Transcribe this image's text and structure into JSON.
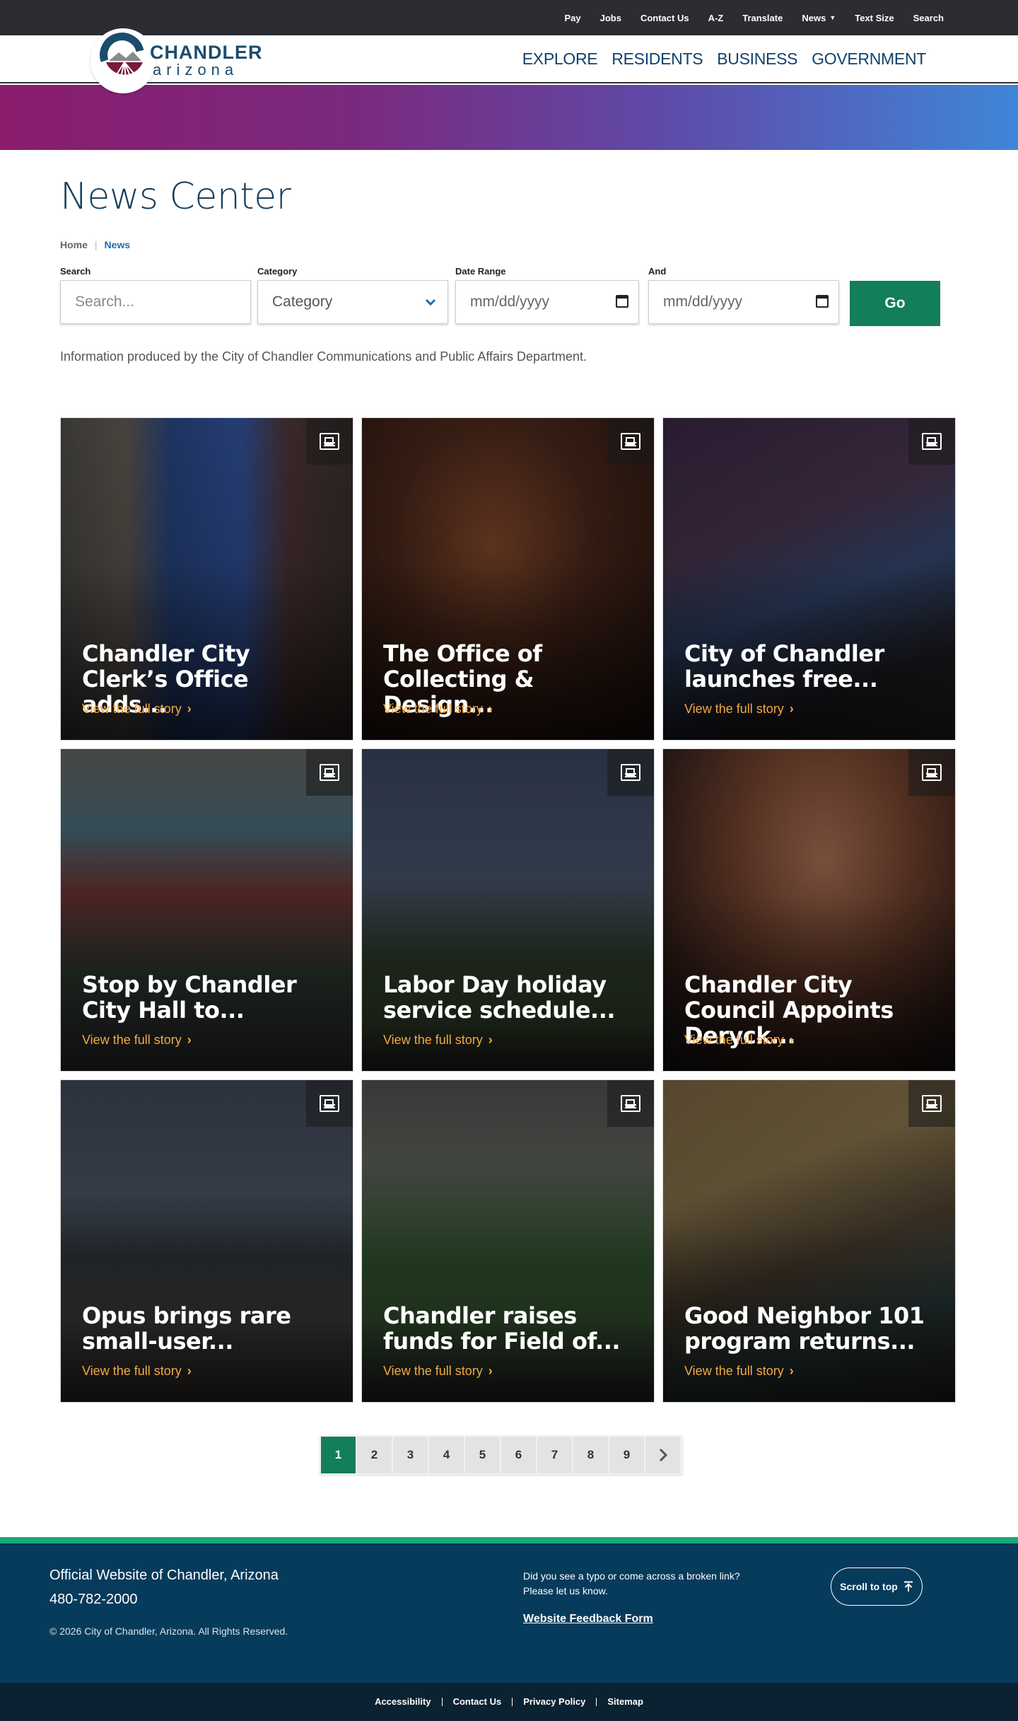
{
  "utility_nav": [
    "Pay",
    "Jobs",
    "Contact Us",
    "A-Z",
    "Translate",
    "News",
    "Text Size",
    "Search"
  ],
  "logo": {
    "line1": "CHANDLER",
    "line2": "arizona"
  },
  "main_nav": [
    "EXPLORE",
    "RESIDENTS",
    "BUSINESS",
    "GOVERNMENT"
  ],
  "page_title": "News Center",
  "breadcrumb": {
    "home": "Home",
    "current": "News"
  },
  "filters": {
    "search_label": "Search",
    "search_placeholder": "Search...",
    "category_label": "Category",
    "category_value": "Category",
    "date_label": "Date Range",
    "date_from": "mm/dd/yyyy",
    "and_label": "And",
    "date_to": "mm/dd/yyyy",
    "go_label": "Go"
  },
  "info_text": "Information produced by the City of Chandler Communications and Public Affairs Department.",
  "cards": [
    {
      "title": "Chandler City Clerk’s Office adds...",
      "link": "View the full story"
    },
    {
      "title": "The Office of Collecting & Design...",
      "link": "View the full story"
    },
    {
      "title": "City of Chandler launches free...",
      "link": "View the full story"
    },
    {
      "title": "Stop by Chandler City Hall to...",
      "link": "View the full story"
    },
    {
      "title": "Labor Day holiday service schedule...",
      "link": "View the full story"
    },
    {
      "title": "Chandler City Council Appoints Deryck...",
      "link": "View the full story"
    },
    {
      "title": "Opus brings rare small-user...",
      "link": "View the full story"
    },
    {
      "title": "Chandler raises funds for Field of...",
      "link": "View the full story"
    },
    {
      "title": "Good Neighbor 101 program returns...",
      "link": "View the full story"
    }
  ],
  "pagination": {
    "pages": [
      "1",
      "2",
      "3",
      "4",
      "5",
      "6",
      "7",
      "8",
      "9"
    ],
    "current": "1",
    "next": "›"
  },
  "footer": {
    "site": "Official Website of Chandler, Arizona",
    "phone": "480-782-2000",
    "copyright": "© 2026 City of Chandler, Arizona. All Rights Reserved.",
    "typo_line1": "Did you see a typo or come across a broken link?",
    "typo_line2": "Please let us know.",
    "feedback": "Website Feedback Form",
    "scroll_top": "Scroll to top"
  },
  "bottom_links": [
    "Accessibility",
    "Contact Us",
    "Privacy Policy",
    "Sitemap"
  ],
  "colors": {
    "accent": "#137e5a",
    "link": "#1d6db0",
    "footer": "#073b5c",
    "story_link": "#f4a844"
  }
}
